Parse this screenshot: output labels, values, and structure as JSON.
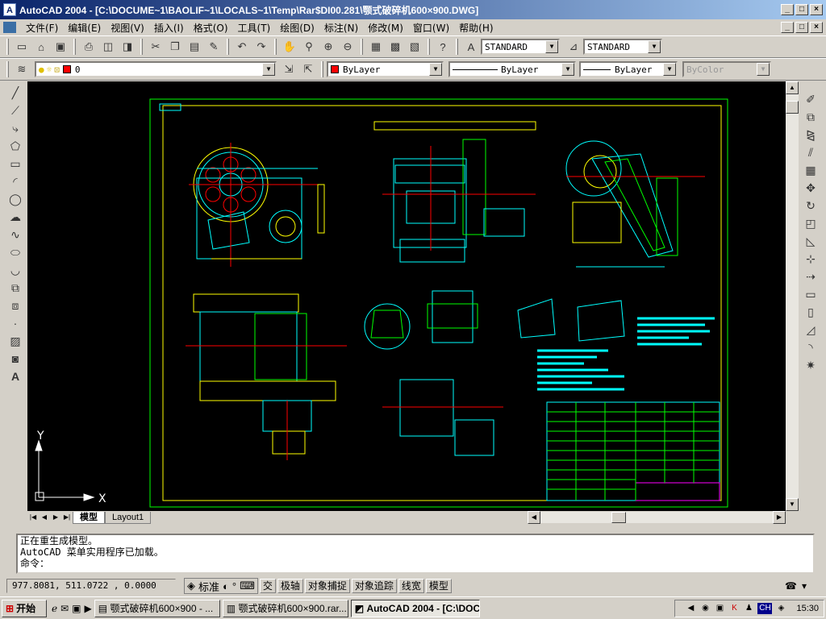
{
  "window": {
    "title": "AutoCAD 2004 - [C:\\DOCUME~1\\BAOLIF~1\\LOCALS~1\\Temp\\Rar$DI00.281\\颚式破碎机600×900.DWG]",
    "app_icon": "A",
    "minimize": "_",
    "maximize": "□",
    "close": "×"
  },
  "menu": {
    "items": [
      "文件(F)",
      "编辑(E)",
      "视图(V)",
      "插入(I)",
      "格式(O)",
      "工具(T)",
      "绘图(D)",
      "标注(N)",
      "修改(M)",
      "窗口(W)",
      "帮助(H)"
    ]
  },
  "toolbar": {
    "text_style": "STANDARD",
    "dim_style": "STANDARD"
  },
  "properties": {
    "layer": "0",
    "color": "ByLayer",
    "linetype": "ByLayer",
    "lineweight": "ByLayer",
    "plotstyle": "ByColor"
  },
  "colors": {
    "canvas": "#000000",
    "drawing_cyan": "#00ffff",
    "drawing_green": "#00ff00",
    "drawing_yellow": "#ffff00",
    "drawing_red": "#ff0000",
    "drawing_magenta": "#ff00ff"
  },
  "layout": {
    "tabs": [
      "模型",
      "Layout1"
    ],
    "active_tab": "模型"
  },
  "ucs": {
    "x_label": "X",
    "y_label": "Y"
  },
  "command": {
    "lines": [
      "正在重生成模型。",
      "AutoCAD 菜单实用程序已加载。",
      "命令："
    ]
  },
  "status": {
    "coords": "977.8081, 511.0722 , 0.0000",
    "ime_label": "标准",
    "buttons": [
      "交",
      "极轴",
      "对象捕捉",
      "对象追踪",
      "线宽",
      "模型"
    ]
  },
  "taskbar": {
    "start": "开始",
    "tasks": [
      "颚式破碎机600×900 - ...",
      "颚式破碎机600×900.rar...",
      "AutoCAD 2004 - [C:\\DOC..."
    ],
    "active_task": 2,
    "ime": "CH",
    "clock": "15:30"
  }
}
